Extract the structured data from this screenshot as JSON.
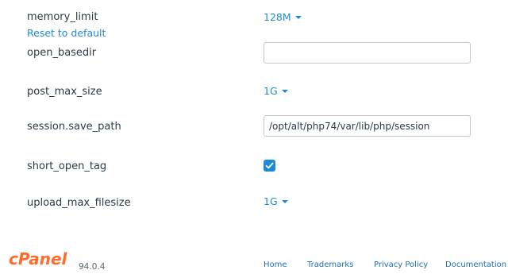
{
  "settings": [
    {
      "label": "memory_limit",
      "value": "128M",
      "reset_label": "Reset to default"
    },
    {
      "label": "open_basedir",
      "value": ""
    },
    {
      "label": "post_max_size",
      "value": "1G"
    },
    {
      "label": "session.save_path",
      "value": "/opt/alt/php74/var/lib/php/session"
    },
    {
      "label": "short_open_tag",
      "checked": true
    },
    {
      "label": "upload_max_filesize",
      "value": "1G"
    }
  ],
  "footer": {
    "logo_text": "cPanel",
    "version": "94.0.4",
    "links": [
      "Home",
      "Trademarks",
      "Privacy Policy",
      "Documentation"
    ]
  },
  "colors": {
    "accent": "#1d8ad6",
    "logo": "#ff6c2c",
    "text": "#293a4a"
  }
}
